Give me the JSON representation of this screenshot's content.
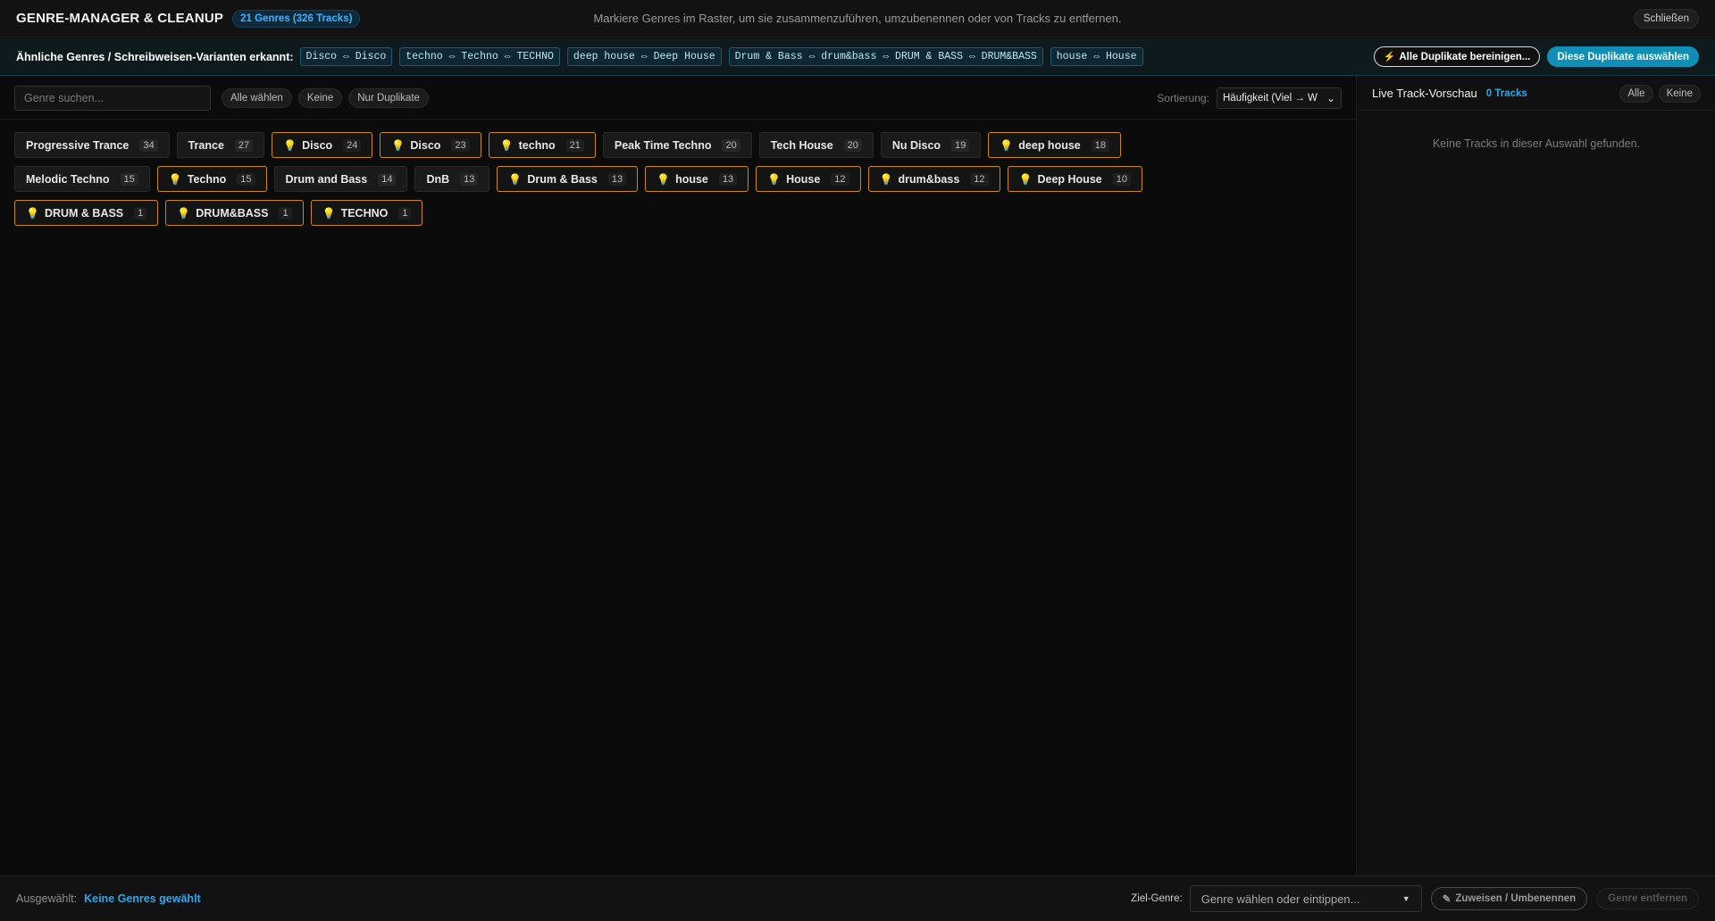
{
  "header": {
    "title": "GENRE-MANAGER & CLEANUP",
    "badge": "21 Genres (326 Tracks)",
    "hint": "Markiere Genres im Raster, um sie zusammenzuführen, umzubenennen oder von Tracks zu entfernen.",
    "close_label": "Schließen"
  },
  "duplicates": {
    "title": "Ähnliche Genres / Schreibweisen-Varianten erkannt:",
    "groups": [
      "Disco ⇔ Disco",
      "techno ⇔ Techno ⇔ TECHNO",
      "deep house ⇔ Deep House",
      "Drum & Bass ⇔ drum&bass ⇔ DRUM & BASS ⇔ DRUM&BASS",
      "house ⇔ House"
    ],
    "clean_all_label": "Alle Duplikate bereinigen...",
    "select_label": "Diese Duplikate auswählen"
  },
  "toolbar": {
    "search_placeholder": "Genre suchen...",
    "select_all": "Alle wählen",
    "select_none": "Keine",
    "only_dups": "Nur Duplikate",
    "sort_label": "Sortierung:",
    "sort_value": "Häufigkeit (Viel → W"
  },
  "genres": [
    {
      "name": "Progressive Trance",
      "count": "34",
      "dup": false
    },
    {
      "name": "Trance",
      "count": "27",
      "dup": false
    },
    {
      "name": "Disco",
      "count": "24",
      "dup": true
    },
    {
      "name": "Disco",
      "count": "23",
      "dup": true
    },
    {
      "name": "techno",
      "count": "21",
      "dup": true
    },
    {
      "name": "Peak Time Techno",
      "count": "20",
      "dup": false
    },
    {
      "name": "Tech House",
      "count": "20",
      "dup": false
    },
    {
      "name": "Nu Disco",
      "count": "19",
      "dup": false
    },
    {
      "name": "deep house",
      "count": "18",
      "dup": true
    },
    {
      "name": "Melodic Techno",
      "count": "15",
      "dup": false
    },
    {
      "name": "Techno",
      "count": "15",
      "dup": true
    },
    {
      "name": "Drum and Bass",
      "count": "14",
      "dup": false
    },
    {
      "name": "DnB",
      "count": "13",
      "dup": false
    },
    {
      "name": "Drum & Bass",
      "count": "13",
      "dup": true
    },
    {
      "name": "house",
      "count": "13",
      "dup": true
    },
    {
      "name": "House",
      "count": "12",
      "dup": true
    },
    {
      "name": "drum&bass",
      "count": "12",
      "dup": true
    },
    {
      "name": "Deep House",
      "count": "10",
      "dup": true
    },
    {
      "name": "DRUM & BASS",
      "count": "1",
      "dup": true
    },
    {
      "name": "DRUM&BASS",
      "count": "1",
      "dup": true
    },
    {
      "name": "TECHNO",
      "count": "1",
      "dup": true
    }
  ],
  "preview": {
    "title": "Live Track-Vorschau",
    "count": "0 Tracks",
    "all_label": "Alle",
    "none_label": "Keine",
    "empty_text": "Keine Tracks in dieser Auswahl gefunden."
  },
  "footer": {
    "selected_label": "Ausgewählt:",
    "selected_value": "Keine Genres gewählt",
    "target_label": "Ziel-Genre:",
    "target_placeholder": "Genre wählen oder eintippen...",
    "assign_label": "Zuweisen / Umbenennen",
    "remove_label": "Genre entfernen"
  },
  "icons": {
    "bulb": "lightbulb-icon",
    "bolt": "lightning-icon",
    "pencil": "pencil-icon"
  }
}
